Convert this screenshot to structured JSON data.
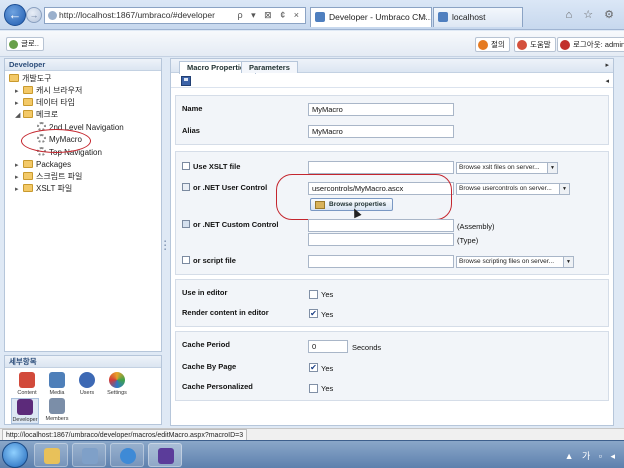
{
  "browser": {
    "url": "http://localhost:1867/umbraco/#developer",
    "addr_icons": "ρ ▾ ⊠ ¢ ×",
    "tabs": [
      {
        "label": "Developer - Umbraco CM..."
      },
      {
        "label": "localhost"
      }
    ],
    "right_icons": "⌂ ☆ ⚙"
  },
  "toolbar": {
    "left_label": "글로..",
    "help_label": "절의",
    "search_label": "도움말",
    "logout_label": "로그아웃: admin"
  },
  "tree": {
    "header": "Developer",
    "nodes": [
      {
        "label": "개발도구"
      },
      {
        "label": "캐시 브라우저"
      },
      {
        "label": "데이터 타입"
      },
      {
        "label": "메크로"
      },
      {
        "label": "2nd Level Navigation"
      },
      {
        "label": "MyMacro"
      },
      {
        "label": "Top Navigation"
      },
      {
        "label": "Packages"
      },
      {
        "label": "스크립트 파일"
      },
      {
        "label": "XSLT 파일"
      }
    ]
  },
  "sections": {
    "header": "세부항목",
    "items": [
      {
        "label": "Content",
        "color": "#d24a3b"
      },
      {
        "label": "Media",
        "color": "#4e7fb9"
      },
      {
        "label": "Users",
        "color": "#3d69b4"
      },
      {
        "label": "Settings",
        "color": "#e9a22a"
      },
      {
        "label": "Developer",
        "color": "#5c2a7a"
      },
      {
        "label": "Members",
        "color": "#7b8ea8"
      }
    ]
  },
  "panel": {
    "tabs": [
      {
        "label": "Macro Properties"
      },
      {
        "label": "Parameters"
      }
    ],
    "name_label": "Name",
    "name_value": "MyMacro",
    "alias_label": "Alias",
    "alias_value": "MyMacro",
    "xslt_label": "Use XSLT file",
    "xslt_select": "Browse xslt files on server...",
    "usercontrol_label": "or .NET User Control",
    "usercontrol_value": "usercontrols/MyMacro.ascx",
    "usercontrol_select": "Browse usercontrols on server...",
    "browse_properties": "Browse properties",
    "custom_label": "or .NET Custom Control",
    "assembly_label": "(Assembly)",
    "type_label": "(Type)",
    "script_label": "or script file",
    "script_select": "Browse scripting files on server...",
    "use_in_editor_label": "Use in editor",
    "use_in_editor_text": "Yes",
    "render_label": "Render content in editor",
    "render_text": "Yes",
    "cache_period_label": "Cache Period",
    "cache_period_value": "0",
    "seconds_label": "Seconds",
    "cache_page_label": "Cache By Page",
    "cache_page_text": "Yes",
    "cache_personalized_label": "Cache Personalized",
    "cache_personalized_text": "Yes"
  },
  "status": {
    "text": "http://localhost:1867/umbraco/developer/macros/editMacro.aspx?macroID=3"
  },
  "taskbar": {
    "tray": "▲ 가 ▫ ◂"
  },
  "colors": {
    "highlight_ellipse": "#c4262e",
    "accent": "#2c4d7a"
  }
}
